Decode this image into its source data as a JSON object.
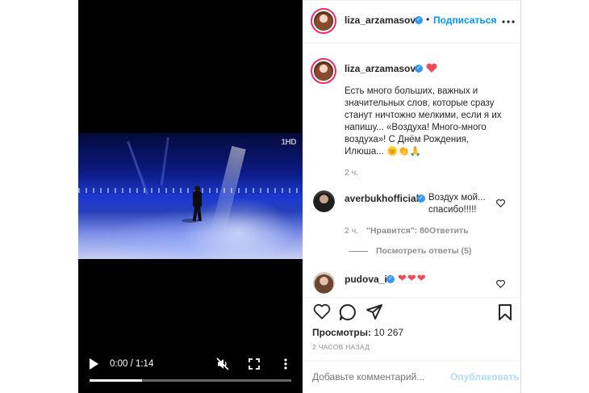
{
  "video": {
    "channel_logo": "1HD",
    "time_display": "0:00 / 1:14",
    "progress": 0.26
  },
  "header": {
    "username": "liza_arzamasova",
    "verified_icon": "verified-badge-icon",
    "separator": "•",
    "follow_label": "Подписаться"
  },
  "caption": {
    "username": "liza_arzamasova",
    "text": "Есть много больших, важных и значительных слов, которые сразу станут ничтожно мелкими, если я их напишу... «Воздуха! Много-много воздуха»! С Днём Рождения, Илюша... 🌞👏🙏",
    "time": "2 ч."
  },
  "comments": [
    {
      "username": "averbukhofficial",
      "text": "Воздух мой... спасибо!!!!!",
      "time": "2 ч.",
      "likes": "\"Нравится\": 80",
      "reply": "Ответить",
      "view_replies": "Посмотреть ответы (5)"
    },
    {
      "username": "pudova_i",
      "text": "❤❤❤"
    }
  ],
  "stats": {
    "views_label": "Просмотры:",
    "views_value": "10 267",
    "posted_ago": "2 ЧАСОВ НАЗАД"
  },
  "composer": {
    "placeholder": "Добавьте комментарий...",
    "publish_label": "Опубликовать"
  },
  "colors": {
    "accent": "#0095f6",
    "heart": "#ed4956",
    "verified": "#3897f0"
  }
}
